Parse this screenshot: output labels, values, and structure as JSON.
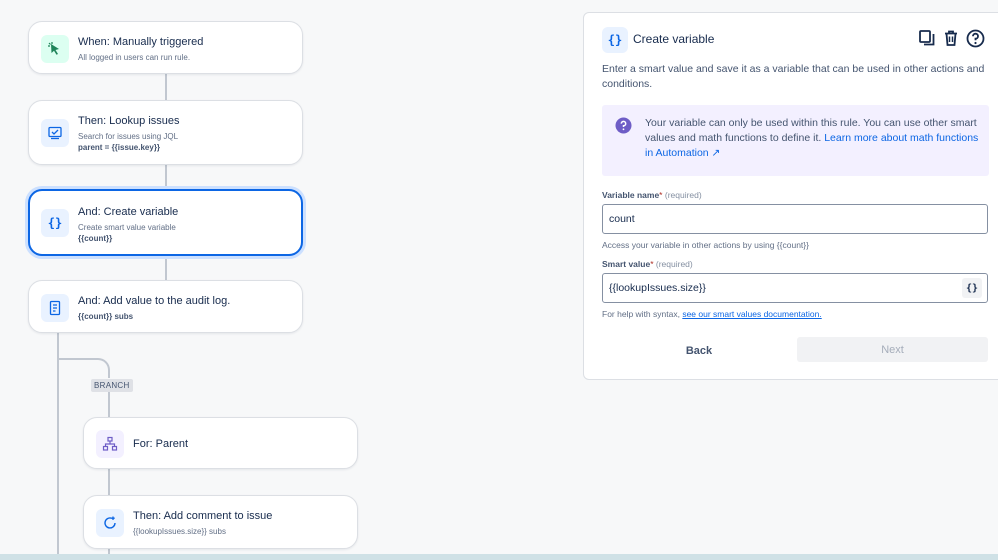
{
  "flow": {
    "cards": [
      {
        "title": "When: Manually triggered",
        "subtitle": "All logged in users can run rule.",
        "icon": "cursor-click-icon"
      },
      {
        "title": "Then: Lookup issues",
        "subtitle": "Search for issues using JQL",
        "detail": "parent = {{issue.key}}",
        "icon": "issue-search-icon"
      },
      {
        "title": "And: Create variable",
        "subtitle": "Create smart value variable",
        "detail": "{{count}}",
        "icon": "braces-icon"
      },
      {
        "title": "And: Add value to the audit log.",
        "detail": "{{count}} subs",
        "icon": "audit-log-icon"
      },
      {
        "title": "For: Parent",
        "icon": "hierarchy-icon"
      },
      {
        "title": "Then: Add comment to issue",
        "subtitle": "{{lookupIssues.size}} subs",
        "icon": "comment-icon"
      }
    ],
    "branch_label": "BRANCH"
  },
  "panel": {
    "icon_text": "{}",
    "title": "Create variable",
    "description": "Enter a smart value and save it as a variable that can be used in other actions and conditions.",
    "info_text": "Your variable can only be used within this rule. You can use other smart values and math functions to define it.",
    "info_link": "Learn more about math functions in Automation ↗",
    "variable_name_label": "Variable name",
    "required_mark": "*",
    "required_text": "(required)",
    "variable_name_value": "count",
    "variable_name_helper": "Access your variable in other actions by using {{count}}",
    "smart_value_label": "Smart value",
    "smart_value_value": "{{lookupIssues.size}}",
    "smart_value_button": "{}",
    "smart_value_helper": "For help with syntax,",
    "smart_value_helper_link": "see our smart values documentation.",
    "back_label": "Back",
    "next_label": "Next"
  },
  "colors": {
    "accent": "#0c66e4",
    "selected_ring": "#cce0ff",
    "info_bg": "#f3f0ff",
    "info_icon": "#6e5dc6",
    "trigger_icon_bg": "#dcfff1",
    "trigger_icon": "#1f845a"
  }
}
